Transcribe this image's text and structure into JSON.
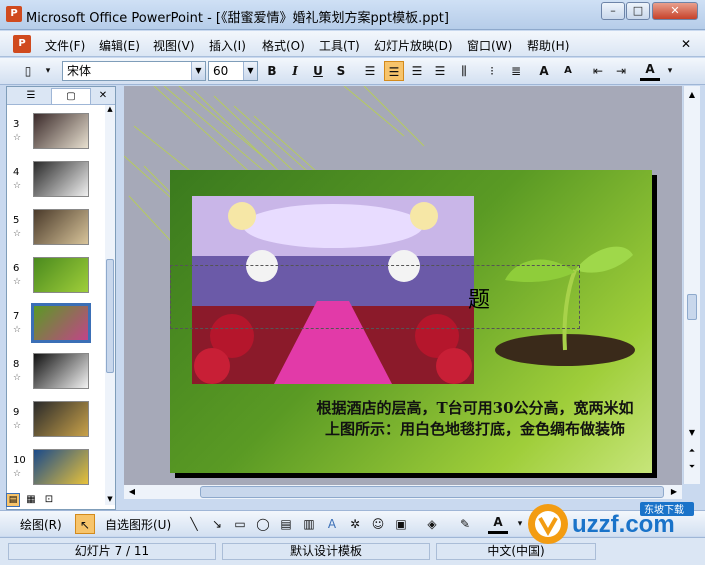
{
  "window": {
    "title": "Microsoft Office PowerPoint - [《甜蜜爱情》婚礼策划方案ppt模板.ppt]",
    "minimize": "–",
    "maximize": "□",
    "close": "✕"
  },
  "menu": {
    "items": [
      "文件(F)",
      "编辑(E)",
      "视图(V)",
      "插入(I)",
      "格式(O)",
      "工具(T)",
      "幻灯片放映(D)",
      "窗口(W)",
      "帮助(H)"
    ],
    "doc_close": "✕"
  },
  "toolbar": {
    "font_name": "宋体",
    "font_size": "60",
    "bold": "B",
    "italic": "I",
    "underline": "U",
    "shadow": "S",
    "grow": "A",
    "shrink": "A",
    "font_color": "A"
  },
  "panel": {
    "close": "✕",
    "slides": [
      {
        "num": "3"
      },
      {
        "num": "4"
      },
      {
        "num": "5"
      },
      {
        "num": "6"
      },
      {
        "num": "7",
        "selected": true
      },
      {
        "num": "8"
      },
      {
        "num": "9"
      },
      {
        "num": "10"
      }
    ]
  },
  "slide": {
    "title_text": "题",
    "body_text": "根据酒店的层高，T台可用30公分高，宽两米如上图所示：用白色地毯打底，金色绸布做装饰"
  },
  "drawbar": {
    "draw": "绘图(R)",
    "autoshapes": "自选图形(U)",
    "font_color": "A"
  },
  "status": {
    "slide_counter": "幻灯片 7 / 11",
    "design": "默认设计模板",
    "language": "中文(中国)"
  },
  "watermark": {
    "brand": "uzzf.com",
    "sub": "东坡下载"
  },
  "colors": {
    "accent": "#f39c12",
    "titlebar": "#cfe0f5",
    "slide_green": "#5a9a24",
    "selected_border": "#3b6fb6"
  }
}
